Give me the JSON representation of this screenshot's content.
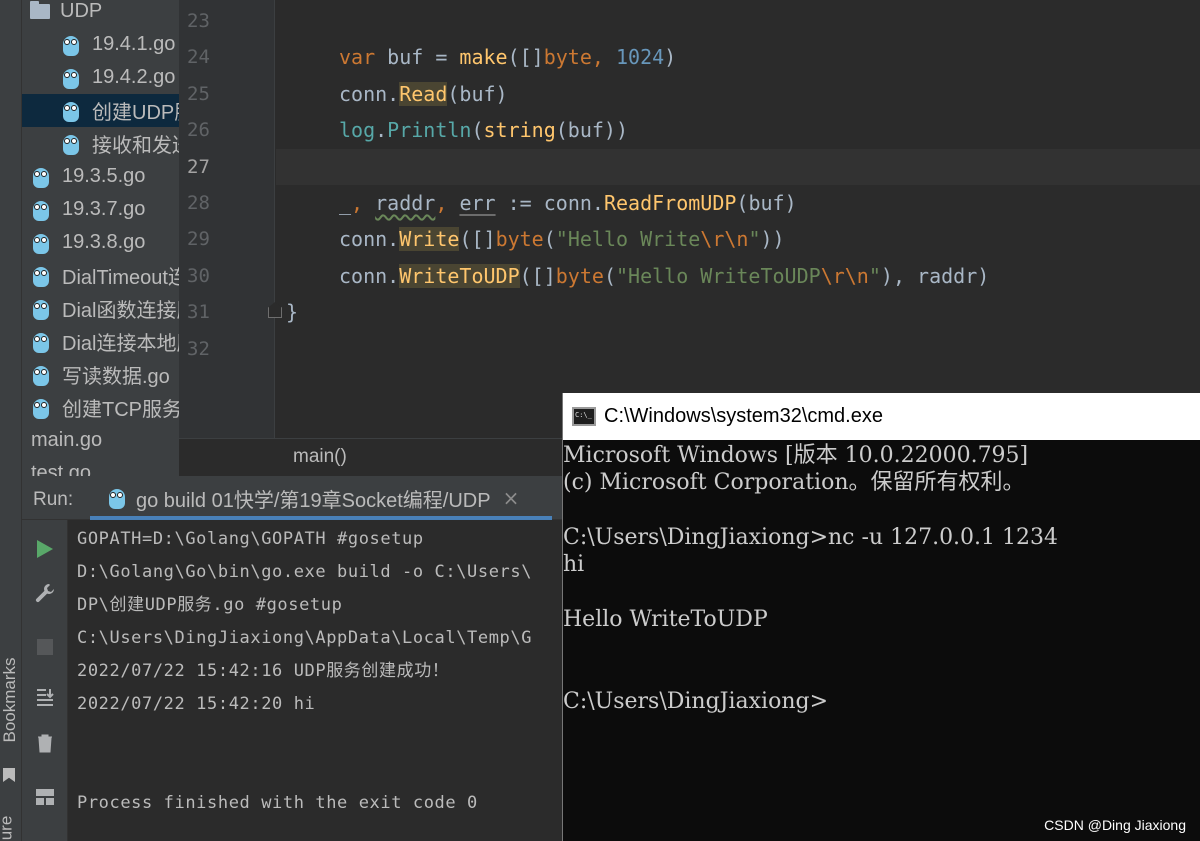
{
  "sidebar": {
    "bookmarks_label": "Bookmarks",
    "structure_label": "ure"
  },
  "project_tree": {
    "items": [
      {
        "label": "UDP",
        "icon": "folder-icon"
      },
      {
        "label": "19.4.1.go",
        "icon": "gopher-icon"
      },
      {
        "label": "19.4.2.go",
        "icon": "gopher-icon"
      },
      {
        "label": "创建UDP服务.go",
        "icon": "gopher-icon",
        "selected": true
      },
      {
        "label": "接收和发送数据.go",
        "icon": "gopher-icon"
      },
      {
        "label": "19.3.5.go",
        "icon": "gopher-icon"
      },
      {
        "label": "19.3.7.go",
        "icon": "gopher-icon"
      },
      {
        "label": "19.3.8.go",
        "icon": "gopher-icon"
      },
      {
        "label": "DialTimeout连接.go",
        "icon": "gopher-icon"
      },
      {
        "label": "Dial函数连接服务.go",
        "icon": "gopher-icon"
      },
      {
        "label": "Dial连接本地服务.go",
        "icon": "gopher-icon"
      },
      {
        "label": "写读数据.go",
        "icon": "gopher-icon"
      },
      {
        "label": "创建TCP服务.go",
        "icon": "gopher-icon"
      },
      {
        "label": "main.go",
        "icon": "none"
      },
      {
        "label": "test.go",
        "icon": "none"
      }
    ]
  },
  "editor": {
    "line_numbers": [
      "23",
      "24",
      "25",
      "26",
      "27",
      "28",
      "29",
      "30",
      "31",
      "32"
    ],
    "current_line": "27",
    "lines": [
      [],
      [
        [
          "kw",
          "var "
        ],
        [
          "std",
          "buf = "
        ],
        [
          "fn",
          "make"
        ],
        [
          "std",
          "([]"
        ],
        [
          "kw",
          "byte"
        ],
        [
          "kw",
          ", "
        ],
        [
          "num",
          "1024"
        ],
        [
          "std",
          ")"
        ]
      ],
      [
        [
          "std",
          "conn."
        ],
        [
          "fn hl",
          "Read"
        ],
        [
          "std",
          "(buf)"
        ]
      ],
      [
        [
          "meth",
          "log"
        ],
        [
          "std",
          "."
        ],
        [
          "meth",
          "Println"
        ],
        [
          "std",
          "("
        ],
        [
          "fn",
          "string"
        ],
        [
          "std",
          "(buf))"
        ]
      ],
      [],
      [
        [
          "std",
          "_"
        ],
        [
          "kw",
          ", "
        ],
        [
          "std warn",
          "raddr"
        ],
        [
          "kw",
          ", "
        ],
        [
          "std bound",
          "err"
        ],
        [
          "std",
          " := conn."
        ],
        [
          "fn",
          "ReadFromUDP"
        ],
        [
          "std",
          "(buf)"
        ]
      ],
      [
        [
          "std",
          "conn."
        ],
        [
          "fn hl",
          "Write"
        ],
        [
          "std",
          "([]"
        ],
        [
          "kw",
          "byte"
        ],
        [
          "std",
          "("
        ],
        [
          "str",
          "\"Hello Write"
        ],
        [
          "esc",
          "\\r\\n"
        ],
        [
          "str",
          "\""
        ],
        [
          "std",
          "))"
        ]
      ],
      [
        [
          "std",
          "conn."
        ],
        [
          "fn hl",
          "WriteToUDP"
        ],
        [
          "std",
          "([]"
        ],
        [
          "kw",
          "byte"
        ],
        [
          "std",
          "("
        ],
        [
          "str",
          "\"Hello WriteToUDP"
        ],
        [
          "esc",
          "\\r\\n"
        ],
        [
          "str",
          "\""
        ],
        [
          "std",
          "), "
        ],
        [
          "std",
          "raddr)"
        ]
      ],
      [
        [
          "std",
          "}"
        ]
      ],
      []
    ],
    "breadcrumb": "main()"
  },
  "run_panel": {
    "label": "Run:",
    "tab_label": "go build 01快学/第19章Socket编程/UDP",
    "tab_close": "×",
    "console_lines": [
      "GOPATH=D:\\Golang\\GOPATH #gosetup",
      "D:\\Golang\\Go\\bin\\go.exe build -o C:\\Users\\",
      "DP\\创建UDP服务.go #gosetup",
      "C:\\Users\\DingJiaxiong\\AppData\\Local\\Temp\\G",
      "2022/07/22 15:42:16 UDP服务创建成功！",
      "2022/07/22 15:42:20 hi",
      "",
      "",
      "Process finished with the exit code 0"
    ]
  },
  "cmd": {
    "title": "C:\\Windows\\system32\\cmd.exe",
    "lines": [
      "Microsoft Windows [版本 10.0.22000.795]",
      "(c) Microsoft Corporation。保留所有权利。",
      "",
      "C:\\Users\\DingJiaxiong>nc -u 127.0.0.1 1234",
      "hi",
      "",
      "Hello WriteToUDP",
      "",
      "",
      "C:\\Users\\DingJiaxiong>"
    ]
  },
  "watermark": "CSDN @Ding Jiaxiong"
}
